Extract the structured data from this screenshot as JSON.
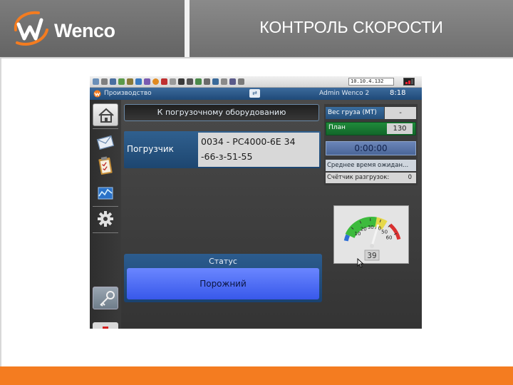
{
  "slide": {
    "logo_text": "Wenco",
    "title": "КОНТРОЛЬ СКОРОСТИ"
  },
  "app": {
    "toolbar": {
      "ip_address": "10.10.4.132"
    },
    "titlebar": {
      "screen": "Производство",
      "user": "Admin Wenco 2",
      "time": "8:18"
    },
    "nav_icons": [
      "home-icon",
      "mail-icon",
      "clipboard-icon",
      "chart-icon",
      "gear-icon",
      "key-icon",
      "first-aid-icon"
    ],
    "main": {
      "loader_nav_button": "К погрузочному оборудованию",
      "loader_label": "Погрузчик",
      "loader_value_line1": "0034 - PC4000-6E 34",
      "loader_value_line2": "-66-з-51-55",
      "status_label": "Статус",
      "status_value": "Порожний"
    },
    "right_panel": {
      "weight_label": "Вес груза (МТ)",
      "weight_value": "-",
      "plan_label": "План",
      "plan_value": "130",
      "timer": "0:00:00",
      "avg_wait_label": "Среднее время ожидан...",
      "unload_counter_label": "Счётчик разгрузок:",
      "unload_counter_value": "0"
    },
    "speedometer": {
      "ticks": [
        "10",
        "20",
        "30",
        "40",
        "50",
        "60"
      ],
      "value": "39",
      "speed": 39,
      "colors": {
        "green": "#3dbb3d",
        "yellow": "#e6d84a",
        "red": "#d93030",
        "blue": "#2f6fd6"
      }
    }
  }
}
